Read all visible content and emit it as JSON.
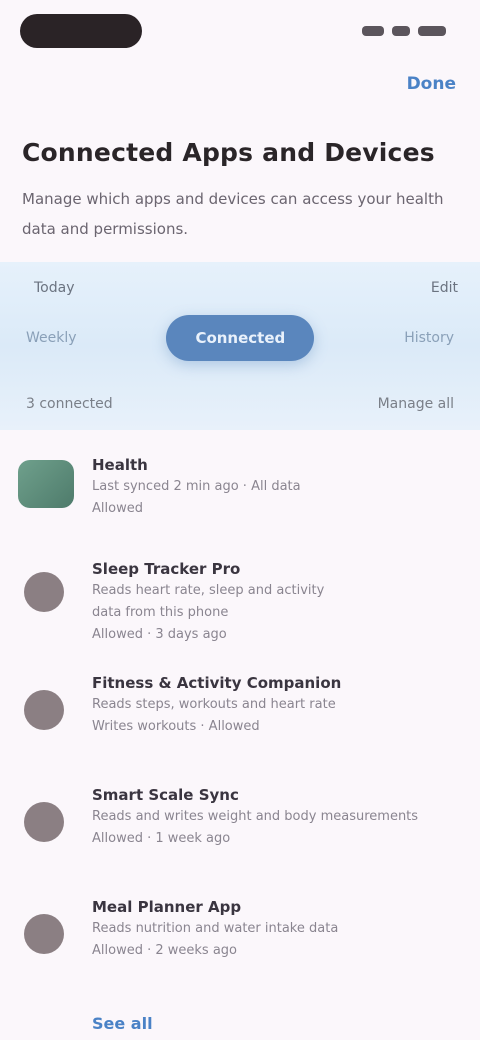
{
  "status": {
    "icons": [
      "signal-icon",
      "wifi-icon",
      "battery-icon"
    ]
  },
  "header": {
    "action_label": "Done"
  },
  "page": {
    "title": "Connected Apps and Devices",
    "subtitle": "Manage which apps and devices can access your health data and permissions."
  },
  "hero": {
    "label": "Today",
    "value": "Edit",
    "segments": [
      "Weekly",
      "Connected",
      "History"
    ],
    "selected_index": 1,
    "foot_left": "3 connected",
    "foot_right": "Manage all"
  },
  "items": [
    {
      "kind": "app",
      "title": "Health",
      "lines": [
        "Last synced 2 min ago · All data",
        "Allowed"
      ]
    },
    {
      "kind": "person",
      "title": "Sleep Tracker Pro",
      "lines": [
        "Reads heart rate, sleep and activity",
        "data from this phone",
        "Allowed · 3 days ago"
      ]
    },
    {
      "kind": "person",
      "title": "Fitness & Activity Companion",
      "lines": [
        "Reads steps, workouts and heart rate",
        "Writes workouts · Allowed"
      ]
    },
    {
      "kind": "person",
      "title": "Smart Scale Sync",
      "lines": [
        "Reads and writes weight and body measurements",
        "Allowed · 1 week ago"
      ]
    },
    {
      "kind": "person",
      "title": "Meal Planner App",
      "lines": [
        "Reads nutrition and water intake data",
        "Allowed · 2 weeks ago"
      ]
    }
  ],
  "footer": {
    "more_label": "See all"
  },
  "colors": {
    "accent": "#4a82c6",
    "segment_selected": "#5a86bd",
    "hero_bg": "#dbeaf8",
    "page_bg": "#fbf7fb"
  }
}
